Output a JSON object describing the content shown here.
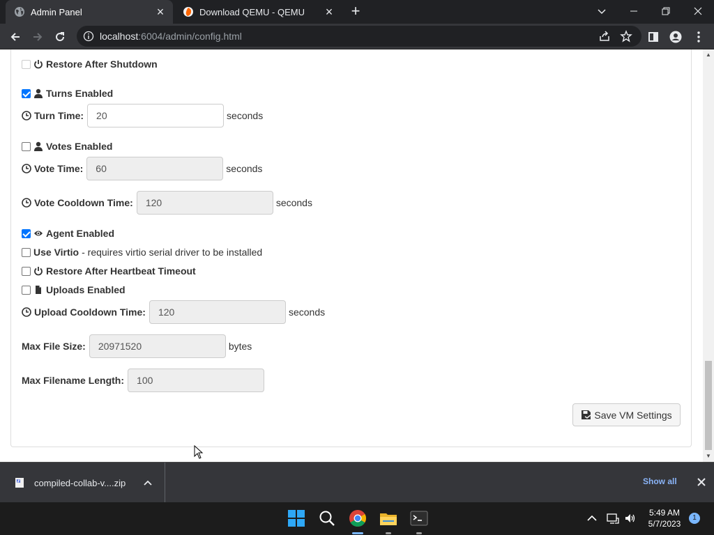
{
  "browser": {
    "tabs": [
      {
        "title": "Admin Panel",
        "active": true,
        "icon": "globe-icon"
      },
      {
        "title": "Download QEMU - QEMU",
        "active": false,
        "icon": "qemu-icon"
      }
    ],
    "new_tab": "+",
    "url_host": "localhost",
    "url_path": ":6004/admin/config.html"
  },
  "form": {
    "restore_after_shutdown": {
      "label": "Restore After Shutdown",
      "checked": false,
      "icon": "power-icon"
    },
    "turns_enabled": {
      "label": "Turns Enabled",
      "checked": true,
      "icon": "user-icon"
    },
    "turn_time": {
      "label": "Turn Time:",
      "value": "20",
      "unit": "seconds",
      "icon": "clock-icon"
    },
    "votes_enabled": {
      "label": "Votes Enabled",
      "checked": false,
      "icon": "user-icon"
    },
    "vote_time": {
      "label": "Vote Time:",
      "value": "60",
      "unit": "seconds",
      "icon": "clock-icon"
    },
    "vote_cooldown_time": {
      "label": "Vote Cooldown Time:",
      "value": "120",
      "unit": "seconds",
      "icon": "clock-icon"
    },
    "agent_enabled": {
      "label": "Agent Enabled",
      "checked": true,
      "icon": "eye-icon"
    },
    "use_virtio": {
      "label": "Use Virtio",
      "note": "- requires virtio serial driver to be installed",
      "checked": false
    },
    "restore_after_heartbeat": {
      "label": "Restore After Heartbeat Timeout",
      "checked": false,
      "icon": "power-icon"
    },
    "uploads_enabled": {
      "label": "Uploads Enabled",
      "checked": false,
      "icon": "file-icon"
    },
    "upload_cooldown_time": {
      "label": "Upload Cooldown Time:",
      "value": "120",
      "unit": "seconds",
      "icon": "clock-icon"
    },
    "max_file_size": {
      "label": "Max File Size:",
      "value": "20971520",
      "unit": "bytes"
    },
    "max_filename_length": {
      "label": "Max Filename Length:",
      "value": "100"
    },
    "save_button": "Save VM Settings"
  },
  "downloads": {
    "file_name": "compiled-collab-v....zip",
    "show_all": "Show all"
  },
  "taskbar": {
    "time": "5:49 AM",
    "date": "5/7/2023",
    "notifications": "1"
  },
  "colors": {
    "accent": "#0075ff",
    "chrome_dark": "#202124",
    "chrome_toolbar": "#35363a",
    "link_blue": "#8ab4f8"
  }
}
